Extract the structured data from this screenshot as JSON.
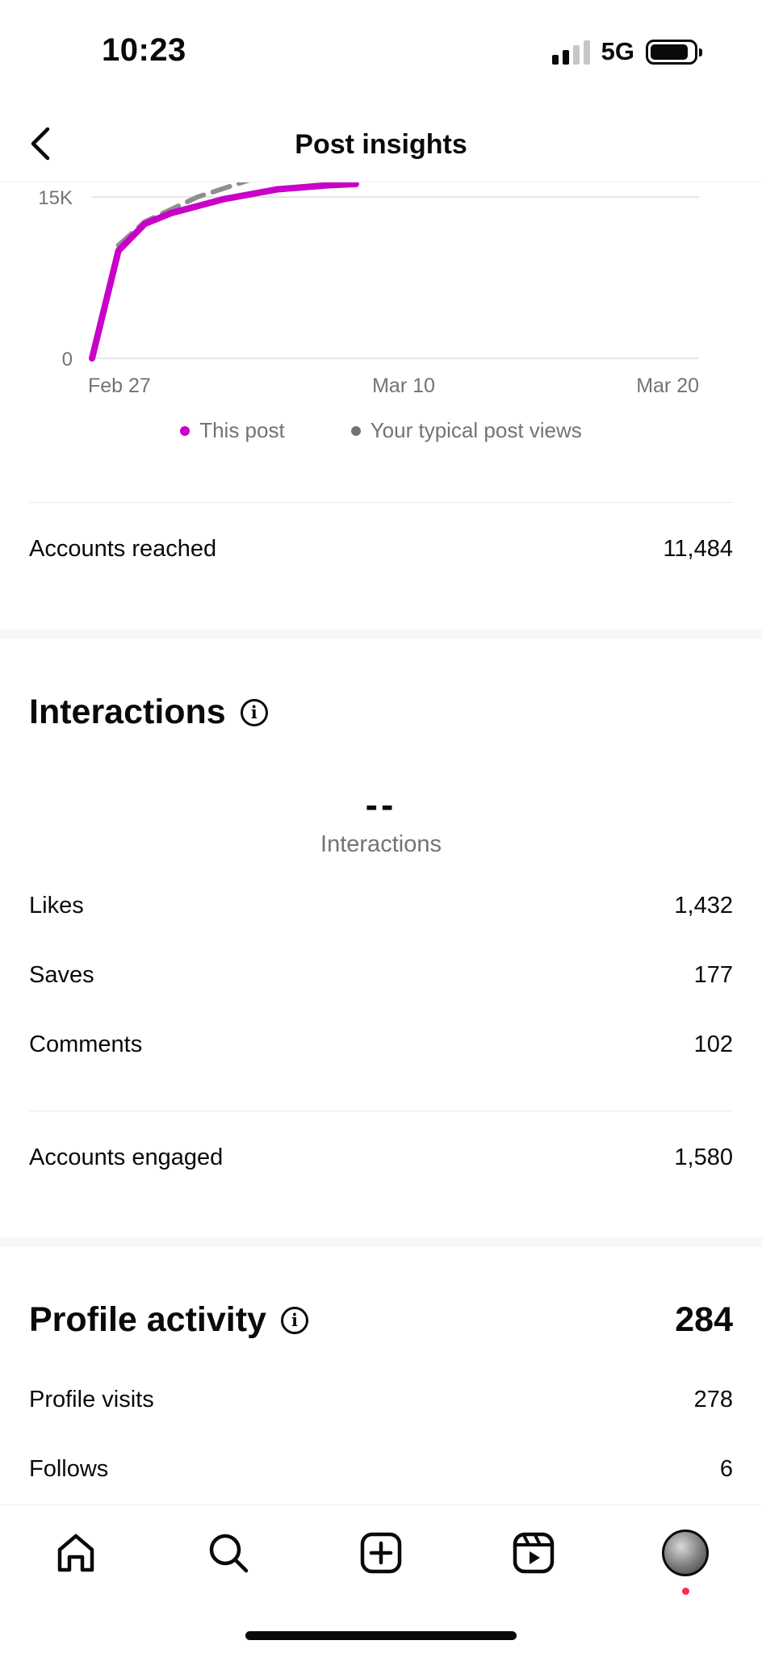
{
  "status_bar": {
    "time": "10:23",
    "network": "5G"
  },
  "header": {
    "title": "Post insights"
  },
  "chart_data": {
    "type": "line",
    "y_ticks": [
      "15K",
      "0"
    ],
    "x_ticks": [
      "Feb 27",
      "Mar 10",
      "Mar 20"
    ],
    "ylim": [
      0,
      20000
    ],
    "grid": true,
    "legend_position": "bottom",
    "series": [
      {
        "name": "This post",
        "color": "#c800c8",
        "style": "solid",
        "points": [
          [
            0,
            0
          ],
          [
            1,
            10000
          ],
          [
            2,
            12500
          ],
          [
            3,
            13500
          ],
          [
            5,
            14800
          ],
          [
            7,
            15700
          ],
          [
            9,
            16100
          ],
          [
            10,
            16200
          ]
        ]
      },
      {
        "name": "Your typical post views",
        "color": "#8e8e8e",
        "style": "dashed",
        "points": [
          [
            1,
            10500
          ],
          [
            2,
            12700
          ],
          [
            4,
            15000
          ],
          [
            6,
            16600
          ],
          [
            7,
            17200
          ]
        ]
      }
    ]
  },
  "reach": {
    "accounts_reached_label": "Accounts reached",
    "accounts_reached_value": "11,484"
  },
  "interactions": {
    "title": "Interactions",
    "total_value": "--",
    "total_label": "Interactions",
    "rows": [
      {
        "label": "Likes",
        "value": "1,432"
      },
      {
        "label": "Saves",
        "value": "177"
      },
      {
        "label": "Comments",
        "value": "102"
      }
    ],
    "accounts_engaged_label": "Accounts engaged",
    "accounts_engaged_value": "1,580"
  },
  "profile_activity": {
    "title": "Profile activity",
    "total": "284",
    "rows": [
      {
        "label": "Profile visits",
        "value": "278"
      },
      {
        "label": "Follows",
        "value": "6"
      }
    ]
  },
  "icons": {
    "back": "chevron-left-icon",
    "info": "info-icon",
    "home": "home-icon",
    "search": "search-icon",
    "create": "plus-square-icon",
    "reels": "reels-icon"
  },
  "colors": {
    "this_post": "#c800c8",
    "typical": "#8e8e8e",
    "notification": "#ff2a4d"
  }
}
